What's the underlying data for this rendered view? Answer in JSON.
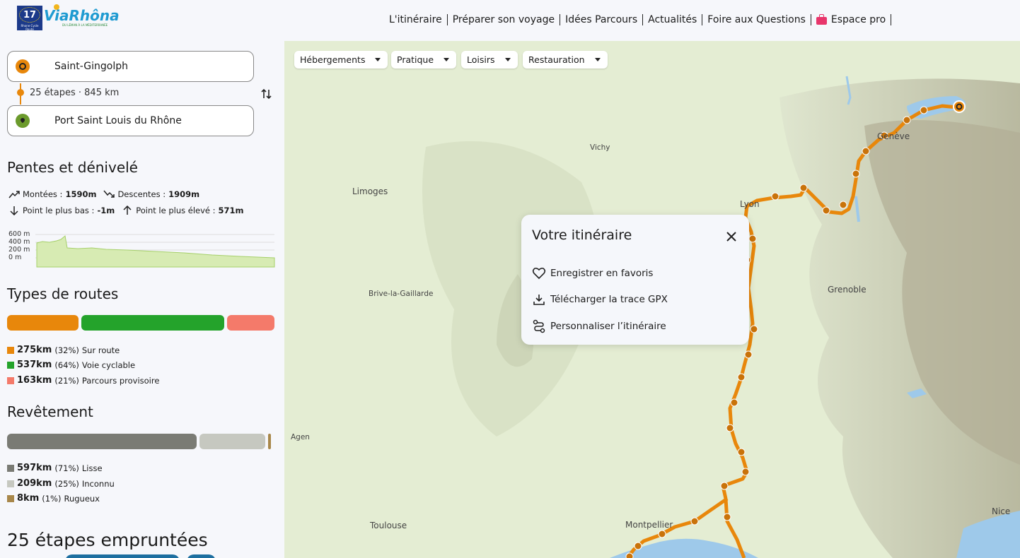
{
  "header": {
    "logo_number": "17",
    "logo_sub": "Rhone Cycle Route",
    "logo_name": "ViaRhôna",
    "logo_tagline": "DU LÉMAN À LA MÉDITERRANÉE",
    "nav": [
      "L'itinéraire",
      "Préparer son voyage",
      "Idées Parcours",
      "Actualités",
      "Foire aux Questions",
      "Espace pro"
    ]
  },
  "route": {
    "start": "Saint-Gingolph",
    "end": "Port Saint Louis du Rhône",
    "summary": "25 étapes · 845 km"
  },
  "slopes": {
    "title": "Pentes et dénivelé",
    "ascent_label": "Montées :",
    "ascent_value": "1590m",
    "descent_label": "Descentes :",
    "descent_value": "1909m",
    "lowest_label": "Point le plus bas :",
    "lowest_value": "-1m",
    "highest_label": "Point le plus élevé :",
    "highest_value": "571m",
    "profile_ticks": [
      "600 m",
      "400 m",
      "200 m",
      "0 m"
    ],
    "profile_color": "#c7e29a"
  },
  "road_types": {
    "title": "Types de routes",
    "items": [
      {
        "value": "275km",
        "pct": "(32%)",
        "label": "Sur route",
        "color": "#e8870b",
        "share": 0.27
      },
      {
        "value": "537km",
        "pct": "(64%)",
        "label": "Voie cyclable",
        "color": "#24a32b",
        "share": 0.54
      },
      {
        "value": "163km",
        "pct": "(21%)",
        "label": "Parcours provisoire",
        "color": "#f47a6a",
        "share": 0.19
      }
    ]
  },
  "surface": {
    "title": "Revêtement",
    "items": [
      {
        "value": "597km",
        "pct": "(71%)",
        "label": "Lisse",
        "color": "#7a7b74",
        "share": 0.71
      },
      {
        "value": "209km",
        "pct": "(25%)",
        "label": "Inconnu",
        "color": "#c6c8c0",
        "share": 0.25
      },
      {
        "value": "8km",
        "pct": "(1%)",
        "label": "Rugueux",
        "color": "#a8874a",
        "share": 0.01
      }
    ]
  },
  "stages_title": "25 étapes empruntées",
  "map": {
    "filters": [
      "Hébergements",
      "Pratique",
      "Loisirs",
      "Restauration"
    ],
    "cities": [
      "Vichy",
      "Limoges",
      "Lyon",
      "Grenoble",
      "Brive-la-Gaillarde",
      "Agen",
      "Toulouse",
      "Montpellier",
      "Nice",
      "Genève"
    ],
    "route_color": "#e8870b"
  },
  "popup": {
    "title": "Votre itinéraire",
    "actions": [
      "Enregistrer en favoris",
      "Télécharger la trace GPX",
      "Personnaliser l’itinéraire"
    ]
  }
}
